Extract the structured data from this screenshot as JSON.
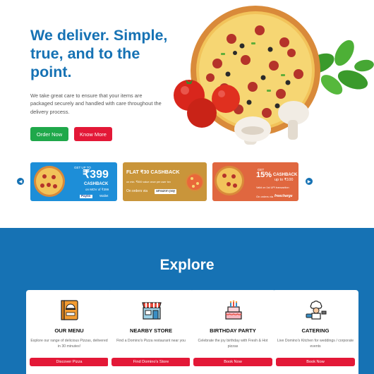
{
  "hero": {
    "title": "We deliver. Simple,\ntrue, and to the\npoint.",
    "description": "We take great care to ensure that your items are packaged securely and handled with care throughout the delivery process.",
    "order_now_label": "Order Now",
    "know_more_label": "Know More"
  },
  "offers": [
    {
      "line1": "GET UP TO",
      "amount": "₹399",
      "line2": "CASHBACK",
      "line3": "on MOV of ₹399",
      "line4": "Paytm",
      "line5": "Wallet"
    },
    {
      "line1": "FLAT ₹30 CASHBACK",
      "line2": "on min. ₹500 value once per user txn",
      "line3": "On orders via",
      "line4": "amazon pay"
    },
    {
      "line1": "GET",
      "amount": "15%",
      "line2": "CASHBACK",
      "line3": "up to ₹100",
      "line4": "Valid on 1st UPI transaction",
      "line5": "On orders via",
      "line6": "freecharge"
    }
  ],
  "explore": {
    "title": "Explore",
    "cards": [
      {
        "title": "OUR MENU",
        "description": "Explore our range of delicious Pizzas, delivered in 30 minutes!",
        "button": "Discover Pizza",
        "icon": "menu-book-icon"
      },
      {
        "title": "NEARBY STORE",
        "description": "Find a Domino's Pizza restaurant near you",
        "button": "Find Domino's Store",
        "icon": "storefront-icon"
      },
      {
        "title": "BIRTHDAY PARTY",
        "description": "Celebrate the joy birthday with Fresh & Hot pizzas",
        "button": "Book Now",
        "icon": "birthday-cake-icon"
      },
      {
        "title": "CATERING",
        "description": "Live Domino's Kitchen for weddings / corporate events",
        "button": "Book Now",
        "icon": "chef-icon"
      }
    ]
  },
  "colors": {
    "brand_blue": "#1672b4",
    "green": "#1fa84a",
    "red": "#e31837"
  }
}
